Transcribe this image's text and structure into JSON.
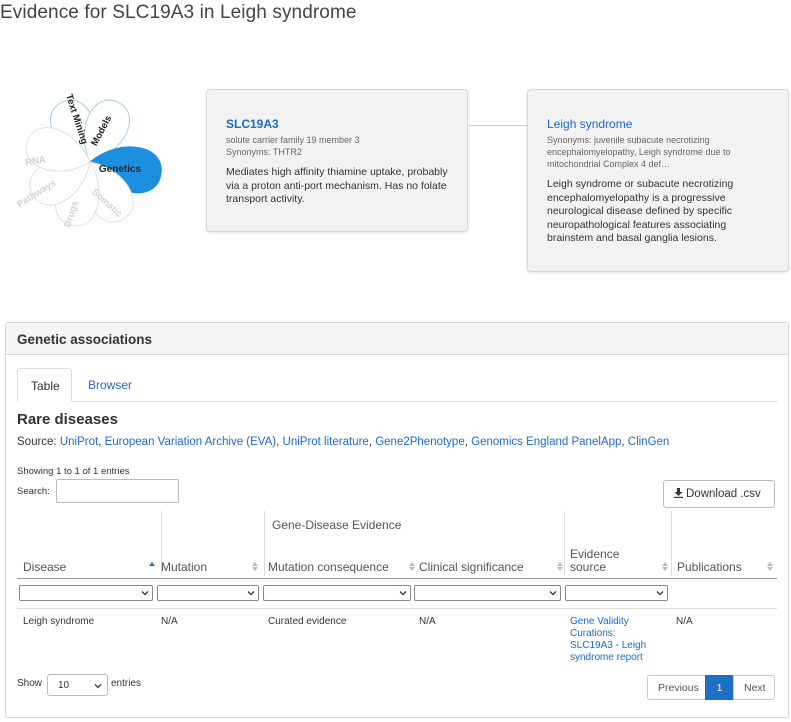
{
  "page": {
    "title": "Evidence for SLC19A3 in Leigh syndrome"
  },
  "flower": {
    "petals": [
      "Text Mining",
      "Models",
      "Genetics",
      "Somatic",
      "Drugs",
      "Pathways",
      "RNA"
    ],
    "active_color": "#1c8fe0",
    "outline_color": "#a6cde9",
    "faded_color": "#e0e0e0"
  },
  "target_card": {
    "symbol": "SLC19A3",
    "name": "solute carrier family 19 member 3",
    "synonyms": "Synonyms: THTR2",
    "description": "Mediates high affinity thiamine uptake, probably via a proton anti-port mechanism. Has no folate transport activity."
  },
  "disease_card": {
    "name": "Leigh syndrome",
    "synonyms": "Synonyms: juvenile subacute necrotizing encephalomyelopathy, Leigh syndrome due to mitochondrial Complex 4 def…",
    "description": "Leigh syndrome or subacute necrotizing encephalomyelopathy is a progressive neurological disease defined by specific neuropathological features associating brainstem and basal ganglia lesions."
  },
  "panel": {
    "title": "Genetic associations",
    "tabs": [
      {
        "label": "Table",
        "active": true
      },
      {
        "label": "Browser",
        "active": false
      }
    ],
    "section_title": "Rare diseases",
    "source_prefix": "Source:",
    "sources": [
      "UniProt",
      "European Variation Archive (EVA)",
      "UniProt literature",
      "Gene2Phenotype",
      "Genomics England PanelApp",
      "ClinGen"
    ],
    "showing": "Showing 1 to 1 of 1 entries",
    "search_label": "Search:",
    "search_value": "",
    "download_label": "Download .csv"
  },
  "table": {
    "group_header": "Gene-Disease Evidence",
    "columns": [
      "Disease",
      "Mutation",
      "Mutation consequence",
      "Clinical significance",
      "Evidence source",
      "Publications"
    ],
    "rows": [
      {
        "disease": "Leigh syndrome",
        "mutation": "N/A",
        "consequence": "Curated evidence",
        "significance": "N/A",
        "evidence_source": "Gene Validity Curations: SLC19A3 - Leigh syndrome report",
        "publications": "N/A"
      }
    ]
  },
  "footer": {
    "show_label": "Show",
    "page_length": "10",
    "entries_label": "entries",
    "previous": "Previous",
    "current_page": "1",
    "next": "Next"
  }
}
